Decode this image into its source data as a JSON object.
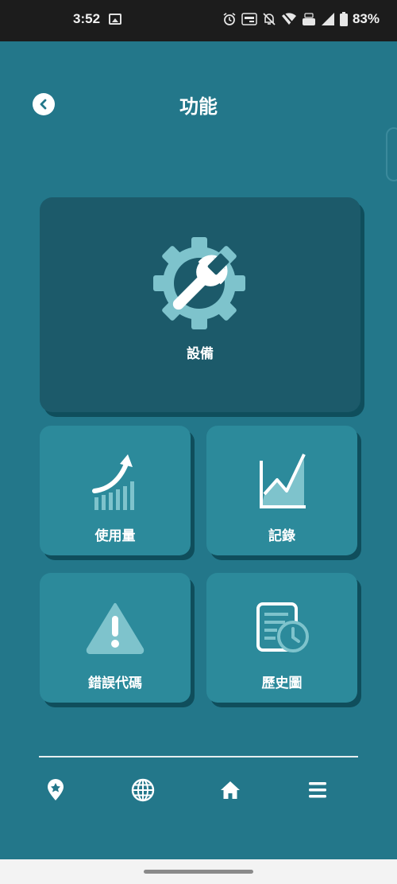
{
  "status_bar": {
    "time": "3:52",
    "battery_percent": "83%",
    "icons": [
      "gallery-icon",
      "alarm-icon",
      "auto-hz-icon",
      "mute-icon",
      "wifi-icon",
      "volte-icon",
      "signal-icon",
      "battery-icon"
    ]
  },
  "header": {
    "title": "功能",
    "back_icon": "chevron-left-icon"
  },
  "features": {
    "main": {
      "label": "設備",
      "icon": "gear-wrench-icon"
    },
    "items": [
      {
        "label": "使用量",
        "icon": "growth-chart-icon"
      },
      {
        "label": "記錄",
        "icon": "area-chart-icon"
      },
      {
        "label": "錯誤代碼",
        "icon": "warning-icon"
      },
      {
        "label": "歷史圖",
        "icon": "history-document-icon"
      }
    ]
  },
  "bottom_nav": {
    "items": [
      "location-pin-icon",
      "globe-icon",
      "home-icon",
      "menu-icon"
    ]
  },
  "colors": {
    "background": "#23778a",
    "main_card": "#1c5a6a",
    "small_card": "#2c8a9b",
    "icon_accent": "#7ec3cc",
    "status_bar": "#1c1c1c"
  }
}
